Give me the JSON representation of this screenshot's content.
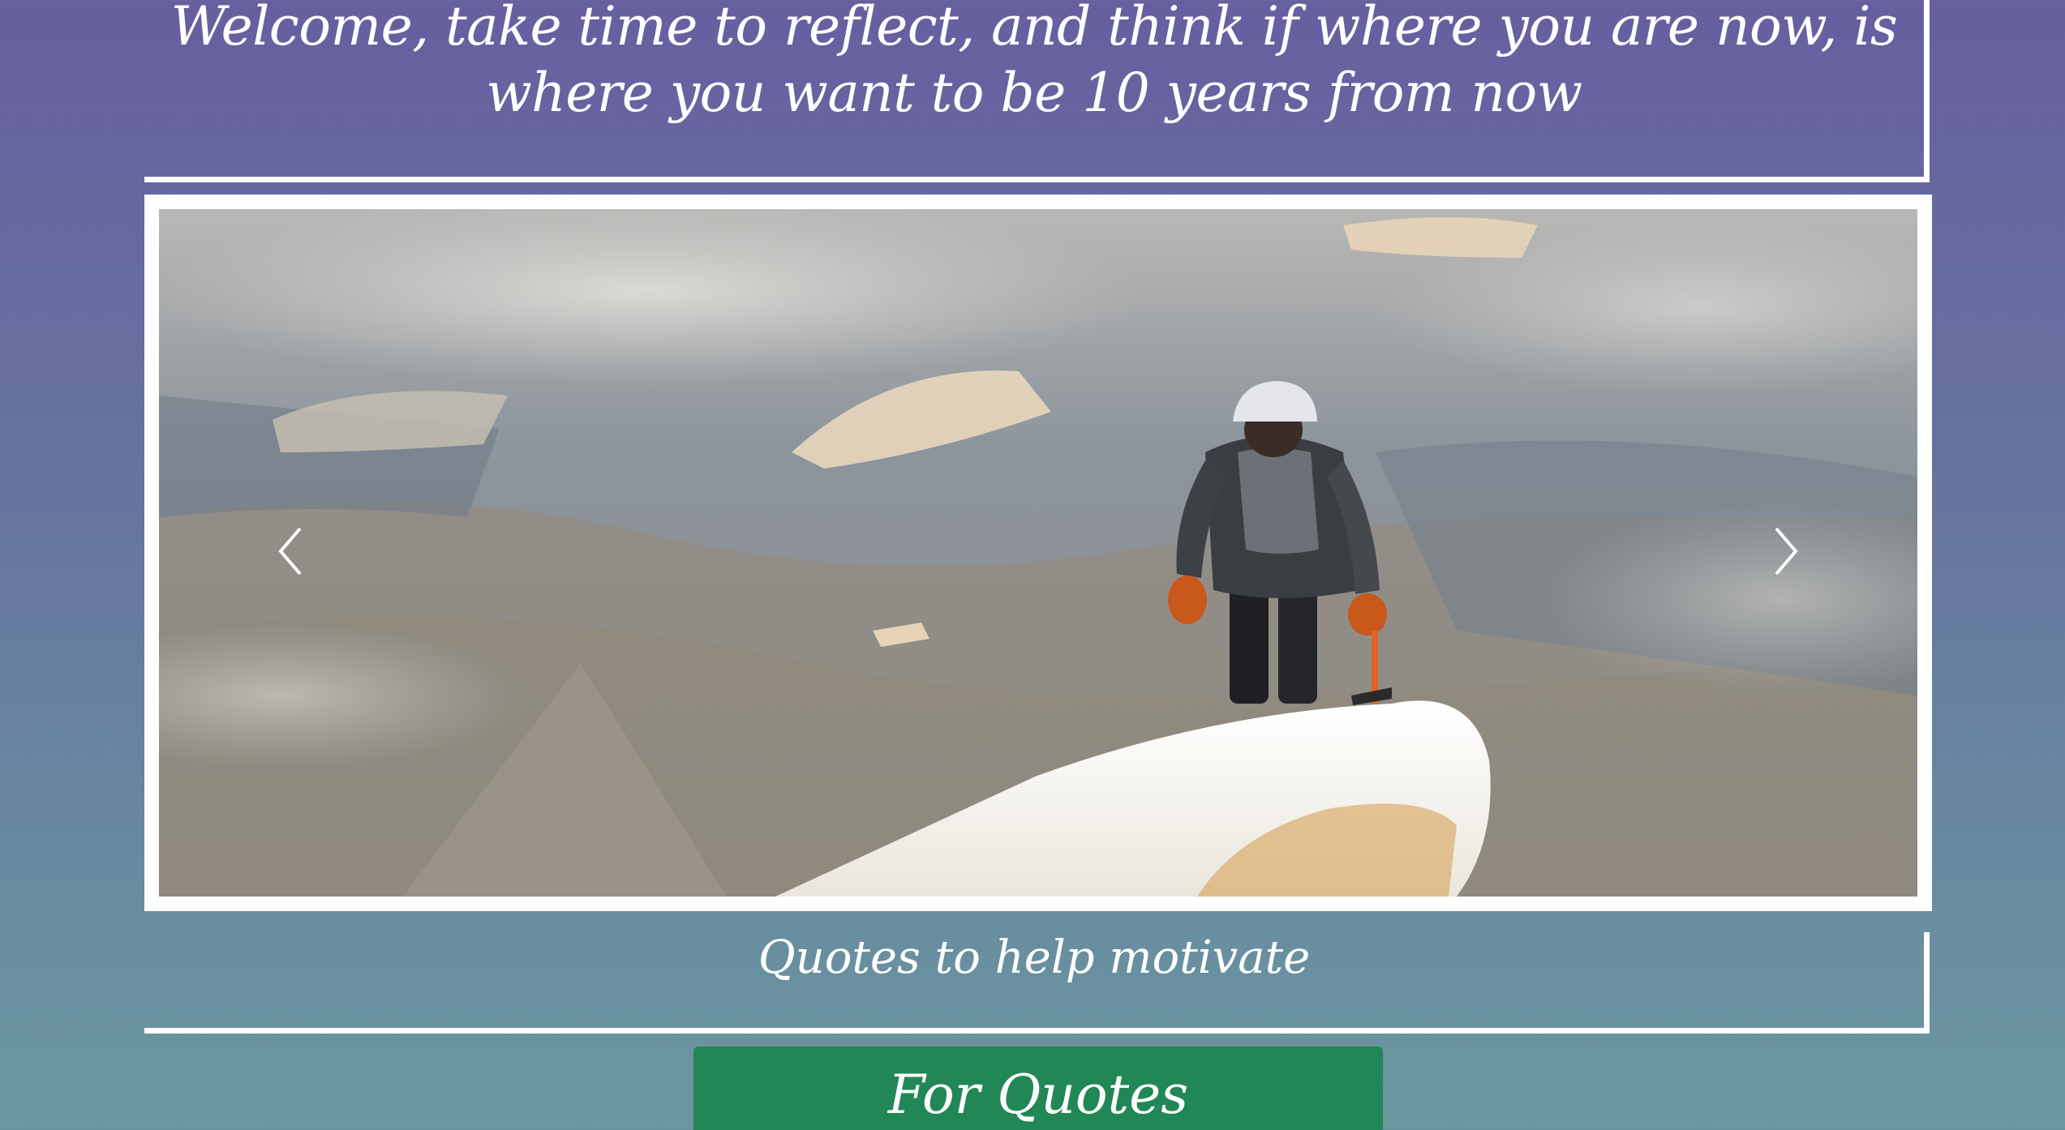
{
  "header": {
    "welcome_text": "Welcome, take time to reflect, and think if where you are now, is where you want to be 10 years from now"
  },
  "carousel": {
    "image_icon": "mountain-climber-photo",
    "prev_icon": "chevron-left-icon",
    "next_icon": "chevron-right-icon"
  },
  "quotes_section": {
    "heading": "Quotes to help motivate",
    "button_label": "For Quotes"
  },
  "colors": {
    "background_top": "#675fa0",
    "background_bottom": "#6b979f",
    "button": "#228756",
    "frame": "#ffffff"
  }
}
